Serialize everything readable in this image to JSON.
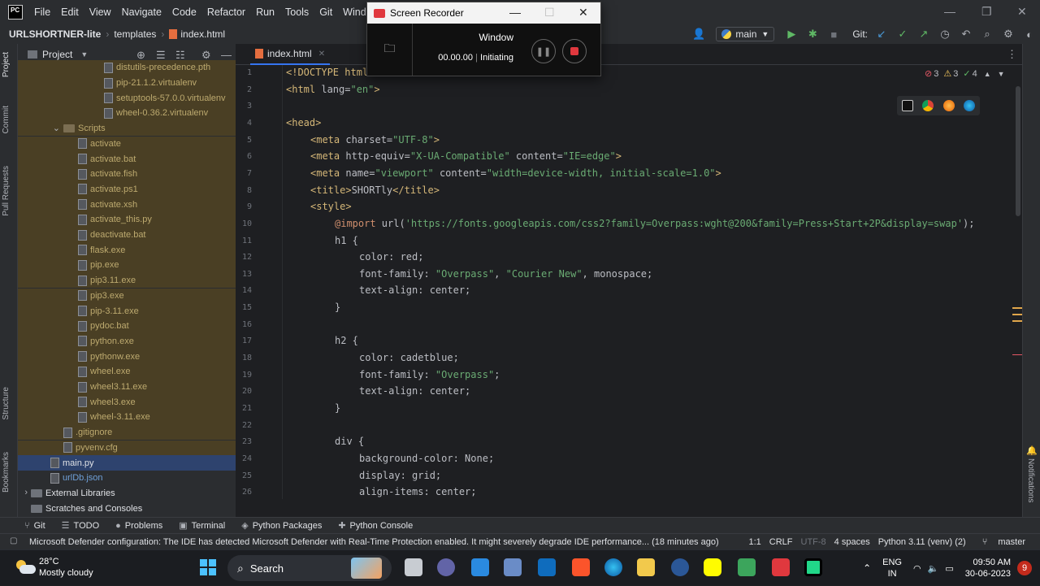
{
  "menubar": {
    "items": [
      "File",
      "Edit",
      "View",
      "Navigate",
      "Code",
      "Refactor",
      "Run",
      "Tools",
      "Git",
      "Window",
      "Hel"
    ],
    "logo_text": "PC"
  },
  "navbar": {
    "breadcrumbs": [
      "URLSHORTNER-lite",
      "templates",
      "index.html"
    ],
    "branch": "main",
    "git_label": "Git:"
  },
  "project_panel": {
    "title": "Project",
    "tree": [
      {
        "label": "distutils-precedence.pth",
        "indent": 106,
        "kind": "file",
        "style": "ignored"
      },
      {
        "label": "pip-21.1.2.virtualenv",
        "indent": 106,
        "kind": "file",
        "style": "ignored"
      },
      {
        "label": "setuptools-57.0.0.virtualenv",
        "indent": 106,
        "kind": "file",
        "style": "ignored"
      },
      {
        "label": "wheel-0.36.2.virtualenv",
        "indent": 106,
        "kind": "file",
        "style": "ignored"
      },
      {
        "label": "Scripts",
        "indent": 56,
        "kind": "dir",
        "style": "ignored",
        "chevron": true
      },
      {
        "label": "activate",
        "indent": 74,
        "kind": "file",
        "style": "ignored"
      },
      {
        "label": "activate.bat",
        "indent": 74,
        "kind": "file",
        "style": "ignored"
      },
      {
        "label": "activate.fish",
        "indent": 74,
        "kind": "file",
        "style": "ignored"
      },
      {
        "label": "activate.ps1",
        "indent": 74,
        "kind": "file",
        "style": "ignored"
      },
      {
        "label": "activate.xsh",
        "indent": 74,
        "kind": "file",
        "style": "ignored"
      },
      {
        "label": "activate_this.py",
        "indent": 74,
        "kind": "file",
        "style": "ignored"
      },
      {
        "label": "deactivate.bat",
        "indent": 74,
        "kind": "file",
        "style": "ignored"
      },
      {
        "label": "flask.exe",
        "indent": 74,
        "kind": "file",
        "style": "ignored"
      },
      {
        "label": "pip.exe",
        "indent": 74,
        "kind": "file",
        "style": "ignored"
      },
      {
        "label": "pip3.11.exe",
        "indent": 74,
        "kind": "file",
        "style": "ignored"
      },
      {
        "label": "pip3.exe",
        "indent": 74,
        "kind": "file",
        "style": "ignored"
      },
      {
        "label": "pip-3.11.exe",
        "indent": 74,
        "kind": "file",
        "style": "ignored"
      },
      {
        "label": "pydoc.bat",
        "indent": 74,
        "kind": "file",
        "style": "ignored"
      },
      {
        "label": "python.exe",
        "indent": 74,
        "kind": "file",
        "style": "ignored"
      },
      {
        "label": "pythonw.exe",
        "indent": 74,
        "kind": "file",
        "style": "ignored"
      },
      {
        "label": "wheel.exe",
        "indent": 74,
        "kind": "file",
        "style": "ignored"
      },
      {
        "label": "wheel3.11.exe",
        "indent": 74,
        "kind": "file",
        "style": "ignored"
      },
      {
        "label": "wheel3.exe",
        "indent": 74,
        "kind": "file",
        "style": "ignored"
      },
      {
        "label": "wheel-3.11.exe",
        "indent": 74,
        "kind": "file",
        "style": "ignored"
      },
      {
        "label": ".gitignore",
        "indent": 56,
        "kind": "file",
        "style": "ignored"
      },
      {
        "label": "pyvenv.cfg",
        "indent": 56,
        "kind": "file",
        "style": "ignored"
      },
      {
        "label": "main.py",
        "indent": 40,
        "kind": "file",
        "style": "normal",
        "selected": true
      },
      {
        "label": "urlDb.json",
        "indent": 40,
        "kind": "file",
        "style": "blue"
      },
      {
        "label": "External Libraries",
        "indent": 16,
        "kind": "lib",
        "style": "normal",
        "chevron": true
      },
      {
        "label": "Scratches and Consoles",
        "indent": 16,
        "kind": "lib",
        "style": "normal"
      }
    ]
  },
  "left_stripe": {
    "tabs": [
      "Project",
      "Commit",
      "Pull Requests",
      "Structure",
      "Bookmarks"
    ]
  },
  "editor": {
    "tab_label": "index.html",
    "inspections": {
      "errors": "3",
      "warnings": "3",
      "weak": "4"
    },
    "lines": [
      {
        "n": "1",
        "indent": 0,
        "parts": [
          [
            "tag",
            "<!DOCTYPE "
          ],
          [
            "tag",
            "html"
          ]
        ]
      },
      {
        "n": "2",
        "indent": 0,
        "parts": [
          [
            "tag",
            "<html "
          ],
          [
            "attr",
            "lang="
          ],
          [
            "str",
            "\"en\""
          ],
          [
            "tag",
            ">"
          ]
        ]
      },
      {
        "n": "3",
        "indent": 0,
        "parts": []
      },
      {
        "n": "4",
        "indent": 0,
        "parts": [
          [
            "tag",
            "<head>"
          ]
        ]
      },
      {
        "n": "5",
        "indent": 4,
        "parts": [
          [
            "tag",
            "<meta "
          ],
          [
            "attr",
            "charset="
          ],
          [
            "str",
            "\"UTF-8\""
          ],
          [
            "tag",
            ">"
          ]
        ]
      },
      {
        "n": "6",
        "indent": 4,
        "parts": [
          [
            "tag",
            "<meta "
          ],
          [
            "attr",
            "http-equiv="
          ],
          [
            "str",
            "\"X-UA-Compatible\""
          ],
          [
            "attr",
            " content="
          ],
          [
            "str",
            "\"IE=edge\""
          ],
          [
            "tag",
            ">"
          ]
        ]
      },
      {
        "n": "7",
        "indent": 4,
        "parts": [
          [
            "tag",
            "<meta "
          ],
          [
            "attr",
            "name="
          ],
          [
            "str",
            "\"viewport\""
          ],
          [
            "attr",
            " content="
          ],
          [
            "str",
            "\"width=device-width, initial-scale=1.0\""
          ],
          [
            "tag",
            ">"
          ]
        ]
      },
      {
        "n": "8",
        "indent": 4,
        "parts": [
          [
            "tag",
            "<title>"
          ],
          [
            "attr",
            "SHORTly"
          ],
          [
            "tag",
            "</title>"
          ]
        ]
      },
      {
        "n": "9",
        "indent": 4,
        "parts": [
          [
            "tag",
            "<style>"
          ]
        ]
      },
      {
        "n": "10",
        "indent": 8,
        "parts": [
          [
            "kw",
            "@import "
          ],
          [
            "prop",
            "url("
          ],
          [
            "str",
            "'https://fonts.googleapis.com/css2?family=Overpass:wght@200&family=Press+Start+2P&display=swap'"
          ],
          [
            "prop",
            ");"
          ]
        ]
      },
      {
        "n": "11",
        "indent": 8,
        "parts": [
          [
            "prop",
            "h1 {"
          ]
        ]
      },
      {
        "n": "12",
        "indent": 12,
        "parts": [
          [
            "prop",
            "color: red;"
          ]
        ]
      },
      {
        "n": "13",
        "indent": 12,
        "parts": [
          [
            "prop",
            "font-family: "
          ],
          [
            "str",
            "\"Overpass\""
          ],
          [
            "prop",
            ", "
          ],
          [
            "str",
            "\"Courier New\""
          ],
          [
            "prop",
            ", monospace;"
          ]
        ]
      },
      {
        "n": "14",
        "indent": 12,
        "parts": [
          [
            "prop",
            "text-align: center;"
          ]
        ]
      },
      {
        "n": "15",
        "indent": 8,
        "parts": [
          [
            "prop",
            "}"
          ]
        ]
      },
      {
        "n": "16",
        "indent": 0,
        "parts": []
      },
      {
        "n": "17",
        "indent": 8,
        "parts": [
          [
            "prop",
            "h2 {"
          ]
        ]
      },
      {
        "n": "18",
        "indent": 12,
        "parts": [
          [
            "prop",
            "color: cadetblue;"
          ]
        ]
      },
      {
        "n": "19",
        "indent": 12,
        "parts": [
          [
            "prop",
            "font-family: "
          ],
          [
            "str",
            "\"Overpass\""
          ],
          [
            "prop",
            ";"
          ]
        ]
      },
      {
        "n": "20",
        "indent": 12,
        "parts": [
          [
            "prop",
            "text-align: center;"
          ]
        ]
      },
      {
        "n": "21",
        "indent": 8,
        "parts": [
          [
            "prop",
            "}"
          ]
        ]
      },
      {
        "n": "22",
        "indent": 0,
        "parts": []
      },
      {
        "n": "23",
        "indent": 8,
        "parts": [
          [
            "prop",
            "div {"
          ]
        ]
      },
      {
        "n": "24",
        "indent": 12,
        "parts": [
          [
            "prop",
            "background-color: None;"
          ]
        ]
      },
      {
        "n": "25",
        "indent": 12,
        "parts": [
          [
            "prop",
            "display: grid;"
          ]
        ]
      },
      {
        "n": "26",
        "indent": 12,
        "parts": [
          [
            "prop",
            "align-items: center;"
          ]
        ]
      }
    ]
  },
  "right_stripe": {
    "notifications_label": "Notifications"
  },
  "bottom_tools": [
    "Git",
    "TODO",
    "Problems",
    "Terminal",
    "Python Packages",
    "Python Console"
  ],
  "statusbar": {
    "message": "Microsoft Defender configuration: The IDE has detected Microsoft Defender with Real-Time Protection enabled. It might severely degrade IDE performance... (18 minutes ago)",
    "position": "1:1",
    "line_sep": "CRLF",
    "encoding": "UTF-8",
    "indent": "4 spaces",
    "interpreter": "Python 3.11 (venv) (2)",
    "branch": "master"
  },
  "recorder": {
    "title": "Screen Recorder",
    "mode": "Window",
    "time": "00.00.00",
    "status": "Initiating"
  },
  "taskbar": {
    "temperature": "28°C",
    "weather": "Mostly cloudy",
    "search_label": "Search",
    "lang_top": "ENG",
    "lang_bottom": "IN",
    "time": "09:50 AM",
    "date": "30-06-2023",
    "notification_count": "9"
  },
  "colors": {
    "accent": "#3574f0",
    "tag": "#d5b778",
    "string": "#6aab73",
    "keyword": "#cf8e6d",
    "error": "#e55765",
    "warning": "#f2c55c"
  }
}
